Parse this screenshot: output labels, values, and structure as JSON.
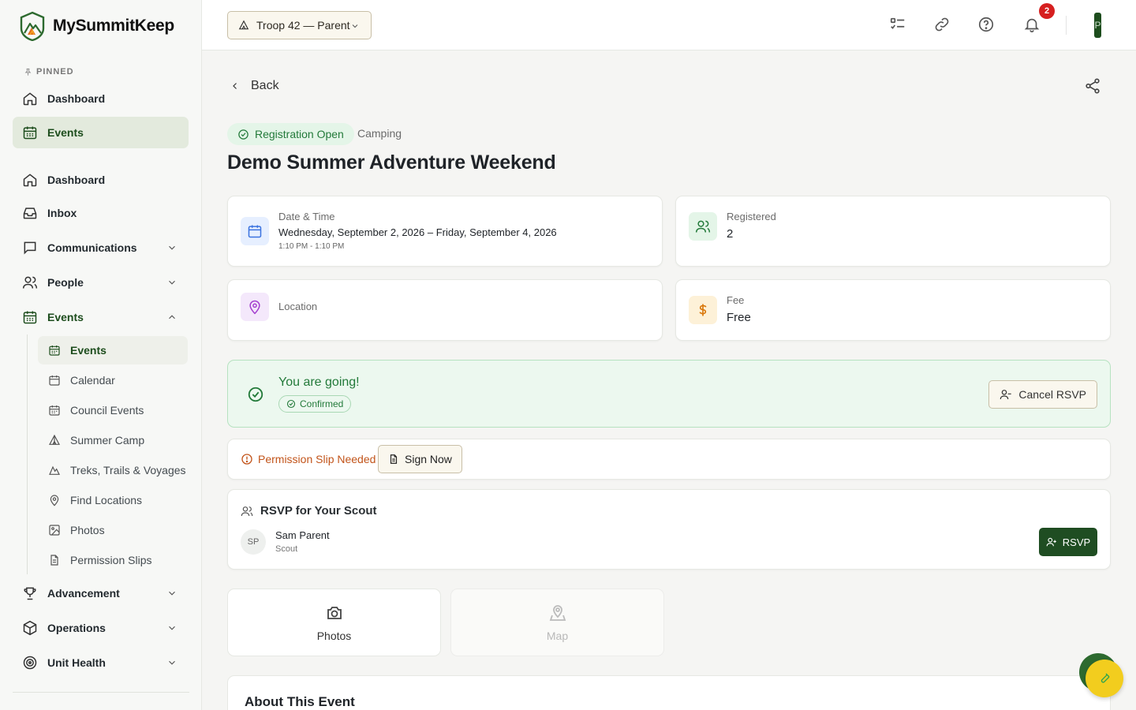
{
  "app": {
    "name": "MySummitKeep"
  },
  "sidebar": {
    "pinned_label": "PINNED",
    "pinned": [
      {
        "label": "Dashboard",
        "icon": "home-icon"
      },
      {
        "label": "Events",
        "icon": "calendar-icon",
        "active": true
      }
    ],
    "items": [
      {
        "label": "Dashboard",
        "icon": "home-icon"
      },
      {
        "label": "Inbox",
        "icon": "inbox-icon"
      },
      {
        "label": "Communications",
        "icon": "message-icon",
        "expandable": true
      },
      {
        "label": "People",
        "icon": "users-icon",
        "expandable": true
      },
      {
        "label": "Events",
        "icon": "calendar-icon",
        "expanded": true
      },
      {
        "label": "Advancement",
        "icon": "trophy-icon",
        "expandable": true
      },
      {
        "label": "Operations",
        "icon": "box-icon",
        "expandable": true
      },
      {
        "label": "Unit Health",
        "icon": "target-icon",
        "expandable": true
      }
    ],
    "events_sub": [
      {
        "label": "Events",
        "icon": "calendar-icon",
        "active": true
      },
      {
        "label": "Calendar",
        "icon": "calendar-icon"
      },
      {
        "label": "Council Events",
        "icon": "calendar-icon"
      },
      {
        "label": "Summer Camp",
        "icon": "tent-icon"
      },
      {
        "label": "Treks, Trails & Voyages",
        "icon": "mountain-icon"
      },
      {
        "label": "Find Locations",
        "icon": "map-pin-icon"
      },
      {
        "label": "Photos",
        "icon": "image-icon"
      },
      {
        "label": "Permission Slips",
        "icon": "file-icon"
      }
    ]
  },
  "topbar": {
    "troop_selector": "Troop 42 — Parent",
    "notifications_count": "2",
    "avatar_initial": "P"
  },
  "page": {
    "back_label": "Back",
    "status": "Registration Open",
    "category": "Camping",
    "title": "Demo Summer Adventure Weekend"
  },
  "info": {
    "date": {
      "label": "Date & Time",
      "value": "Wednesday, September 2, 2026 – Friday, September 4, 2026",
      "sub": "1:10 PM - 1:10 PM"
    },
    "registered": {
      "label": "Registered",
      "value": "2"
    },
    "location": {
      "label": "Location"
    },
    "fee": {
      "label": "Fee",
      "value": "Free"
    }
  },
  "going": {
    "title": "You are going!",
    "badge": "Confirmed",
    "cancel_label": "Cancel RSVP"
  },
  "permission": {
    "text": "Permission Slip Needed",
    "button": "Sign Now"
  },
  "rsvp": {
    "heading": "RSVP for Your Scout",
    "scout": {
      "initials": "SP",
      "name": "Sam Parent",
      "role": "Scout"
    },
    "button": "RSVP"
  },
  "tiles": {
    "photos": "Photos",
    "map": "Map"
  },
  "about": {
    "title": "About This Event"
  },
  "colors": {
    "brand_green": "#1f4d22",
    "success_green": "#237a3a",
    "warning_orange": "#c2541a",
    "badge_red": "#d61f1f",
    "fab_yellow": "#f2cd1e"
  }
}
